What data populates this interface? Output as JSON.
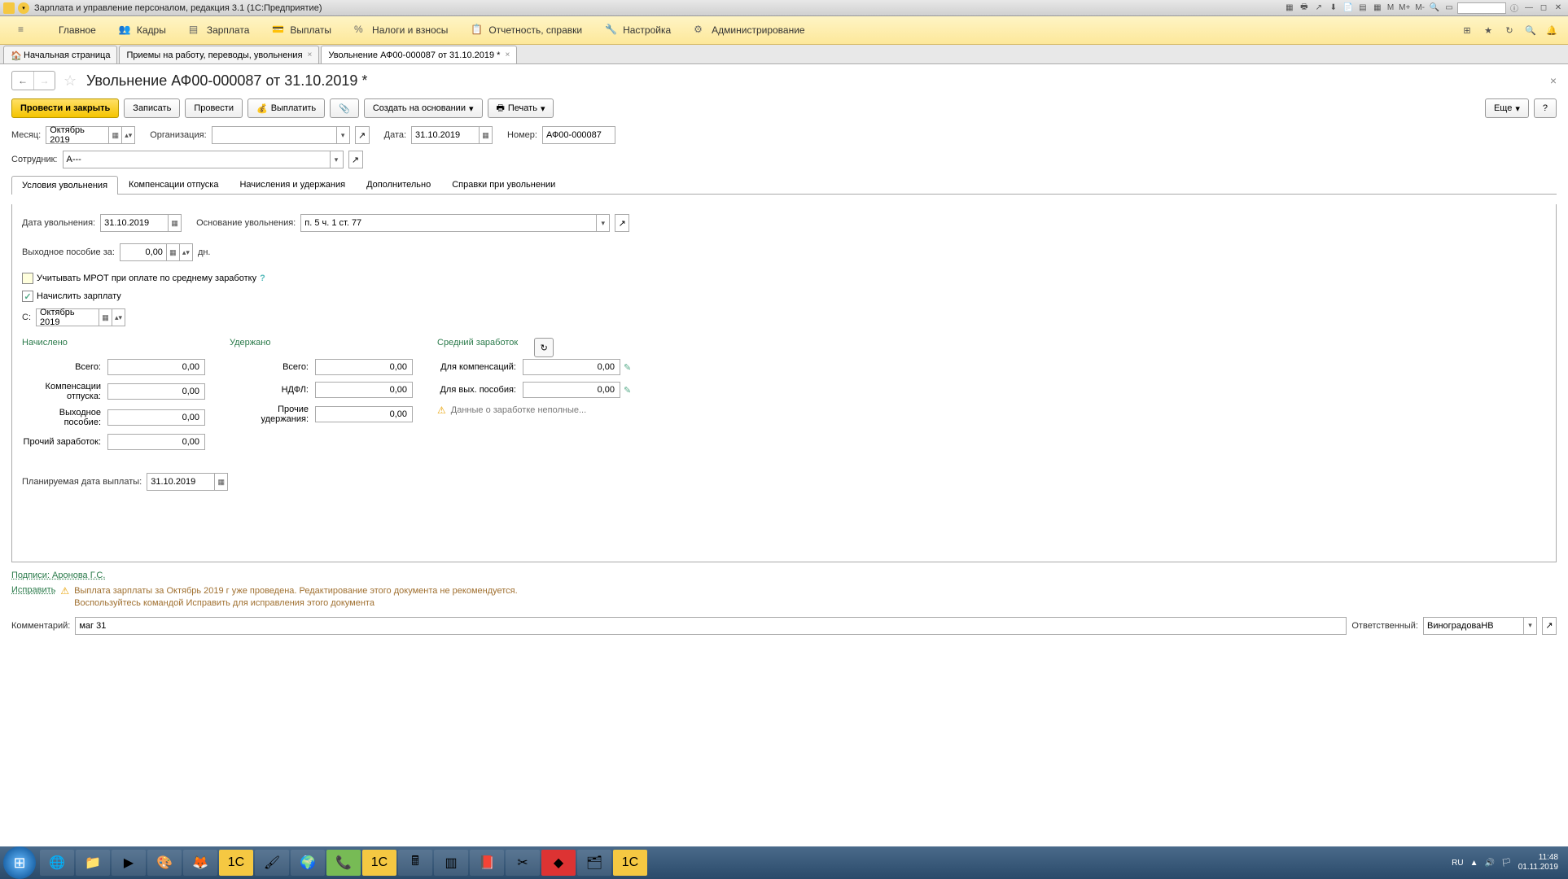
{
  "titlebar": {
    "title": "Зарплата и управление персоналом, редакция 3.1  (1С:Предприятие)",
    "buttons": {
      "m": "M",
      "mplus": "M+",
      "mminus": "M-"
    }
  },
  "mainmenu": {
    "items": [
      {
        "label": "Главное"
      },
      {
        "label": "Кадры"
      },
      {
        "label": "Зарплата"
      },
      {
        "label": "Выплаты"
      },
      {
        "label": "Налоги и взносы"
      },
      {
        "label": "Отчетность, справки"
      },
      {
        "label": "Настройка"
      },
      {
        "label": "Администрирование"
      }
    ]
  },
  "tabs": [
    {
      "label": "Начальная страница",
      "home": true
    },
    {
      "label": "Приемы на работу, переводы, увольнения"
    },
    {
      "label": "Увольнение АФ00-000087 от 31.10.2019 *",
      "active": true
    }
  ],
  "doc": {
    "title": "Увольнение АФ00-000087 от 31.10.2019 *"
  },
  "toolbar": {
    "post_close": "Провести и закрыть",
    "save": "Записать",
    "post": "Провести",
    "pay": "Выплатить",
    "create_based": "Создать на основании",
    "print": "Печать",
    "more": "Еще",
    "help": "?"
  },
  "fields": {
    "month_label": "Месяц:",
    "month": "Октябрь 2019",
    "org_label": "Организация:",
    "org": "",
    "date_label": "Дата:",
    "date": "31.10.2019",
    "number_label": "Номер:",
    "number": "АФ00-000087",
    "employee_label": "Сотрудник:",
    "employee": "А---",
    "dismiss_date_label": "Дата увольнения:",
    "dismiss_date": "31.10.2019",
    "reason_label": "Основание увольнения:",
    "reason": "п. 5 ч. 1 ст. 77",
    "severance_label": "Выходное пособие за:",
    "severance_val": "0,00",
    "severance_unit": "дн.",
    "mrot_label": "Учитывать МРОТ при оплате по среднему заработку",
    "accrue_label": "Начислить зарплату",
    "from_label": "С:",
    "from": "Октябрь 2019",
    "plan_date_label": "Планируемая дата выплаты:",
    "plan_date": "31.10.2019",
    "comment_label": "Комментарий:",
    "comment": "маг 31",
    "responsible_label": "Ответственный:",
    "responsible": "ВиноградоваНВ",
    "signatures": "Подписи: Аронова Г.С.",
    "fix_link": "Исправить"
  },
  "subtabs": [
    "Условия увольнения",
    "Компенсации отпуска",
    "Начисления и удержания",
    "Дополнительно",
    "Справки при увольнении"
  ],
  "summary": {
    "accrued": {
      "title": "Начислено",
      "total_label": "Всего:",
      "total": "0,00",
      "comp_label": "Компенсации отпуска:",
      "comp": "0,00",
      "sev_label": "Выходное пособие:",
      "sev": "0,00",
      "other_label": "Прочий заработок:",
      "other": "0,00"
    },
    "withheld": {
      "title": "Удержано",
      "total_label": "Всего:",
      "total": "0,00",
      "ndfl_label": "НДФЛ:",
      "ndfl": "0,00",
      "other_label": "Прочие удержания:",
      "other": "0,00"
    },
    "average": {
      "title": "Средний заработок",
      "comp_label": "Для компенсаций:",
      "comp": "0,00",
      "sev_label": "Для вых. пособия:",
      "sev": "0,00",
      "warn": "Данные о заработке неполные..."
    }
  },
  "warning": {
    "line1": "Выплата зарплаты за Октябрь 2019 г уже проведена. Редактирование этого документа не рекомендуется.",
    "line2": "Воспользуйтесь командой Исправить для исправления этого документа"
  },
  "taskbar": {
    "lang": "RU",
    "time": "11:48",
    "date": "01.11.2019"
  }
}
